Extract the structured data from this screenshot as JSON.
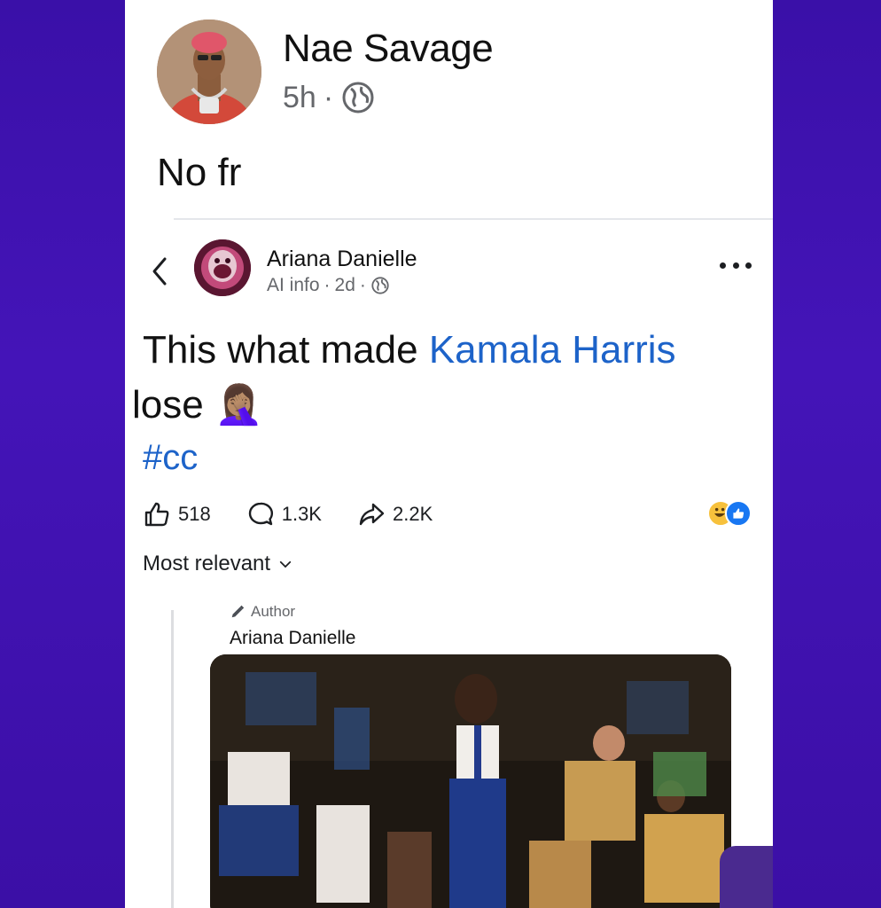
{
  "outer_post": {
    "author": "Nae Savage",
    "time": "5h",
    "separator": "·",
    "text": "No fr"
  },
  "shared_post": {
    "author": "Ariana Danielle",
    "ai_info": "AI info",
    "time": "2d",
    "separator": "·",
    "text_before": "This what made ",
    "text_link": "Kamala Harris",
    "text_after": " lose",
    "emoji": "🤦🏽‍♀️",
    "hashtag": "#cc",
    "likes": "518",
    "comments": "1.3K",
    "shares": "2.2K",
    "sort_label": "Most relevant",
    "comment": {
      "badge": "Author",
      "author": "Ariana Danielle"
    }
  },
  "colors": {
    "background": "#3b0fa6",
    "link": "#1d63c9",
    "meta": "#65676b",
    "like_blue": "#1877f2",
    "haha_yellow": "#f7c13c"
  }
}
